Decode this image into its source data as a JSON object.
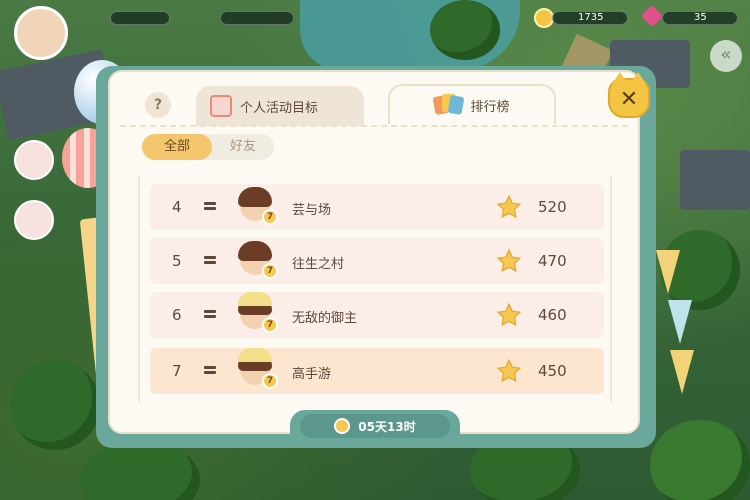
{
  "hud": {
    "coin_value": "1735",
    "gem_value": "35"
  },
  "panel": {
    "help_label": "?",
    "close_label": "✕",
    "tabs": [
      {
        "label": "个人活动目标",
        "active": false
      },
      {
        "label": "排行榜",
        "active": true
      }
    ],
    "filters": [
      {
        "label": "全部",
        "active": true
      },
      {
        "label": "好友",
        "active": false
      }
    ],
    "leaderboard": [
      {
        "rank": "4",
        "name": "芸与场",
        "level": "7",
        "score": "520",
        "is_self": false,
        "hair": "brown"
      },
      {
        "rank": "5",
        "name": "往生之村",
        "level": "7",
        "score": "470",
        "is_self": false,
        "hair": "brown"
      },
      {
        "rank": "6",
        "name": "无敌的御主",
        "level": "7",
        "score": "460",
        "is_self": false,
        "hair": "hat"
      },
      {
        "rank": "7",
        "name": "高手游",
        "level": "7",
        "score": "450",
        "is_self": true,
        "hair": "hat"
      }
    ],
    "timer_text": "05天13时"
  },
  "colors": {
    "accent_teal": "#6aa89c",
    "tab_active_gold": "#f4c76e",
    "self_row": "#fde6cf",
    "row": "#fbeee9",
    "star": "#f7c851"
  }
}
